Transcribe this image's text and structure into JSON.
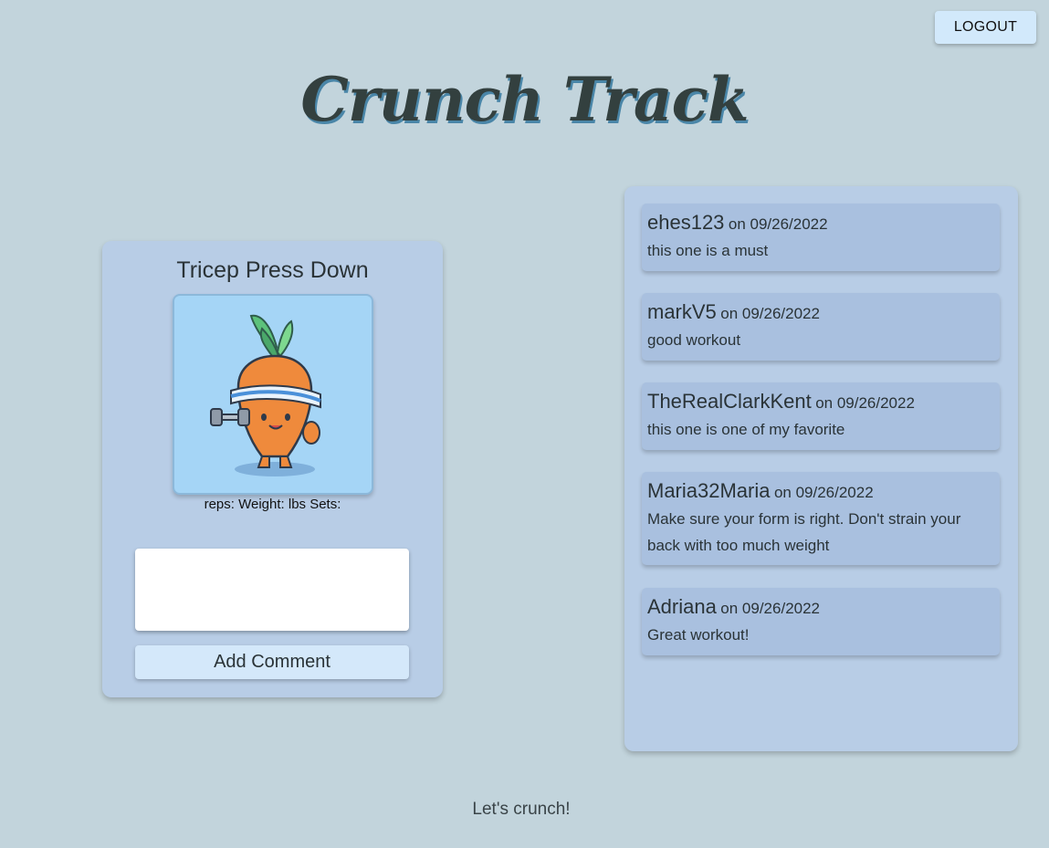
{
  "header": {
    "logout_label": "LOGOUT",
    "app_title": "Crunch Track"
  },
  "exercise": {
    "title": "Tricep Press Down",
    "image_icon": "carrot-with-dumbbell-illustration",
    "stats": "reps: Weight: lbs Sets:",
    "comment_placeholder": "",
    "add_comment_label": "Add Comment"
  },
  "comments": [
    {
      "user": "ehes123",
      "date": "on 09/26/2022",
      "text": "this one is a must"
    },
    {
      "user": "markV5",
      "date": "on 09/26/2022",
      "text": "good workout"
    },
    {
      "user": "TheRealClarkKent",
      "date": "on 09/26/2022",
      "text": "this one is one of my favorite"
    },
    {
      "user": "Maria32Maria",
      "date": "on 09/26/2022",
      "text": "Make sure your form is right. Don't strain your back with too much weight"
    },
    {
      "user": "Adriana",
      "date": "on 09/26/2022",
      "text": "Great workout!"
    }
  ],
  "footer": {
    "text": "Let's crunch!"
  },
  "colors": {
    "background": "#c2d4dc",
    "card": "#b8cde6",
    "comment": "#a9c0df",
    "button": "#d2e9fb",
    "title_shadow": "#4a86a8"
  }
}
